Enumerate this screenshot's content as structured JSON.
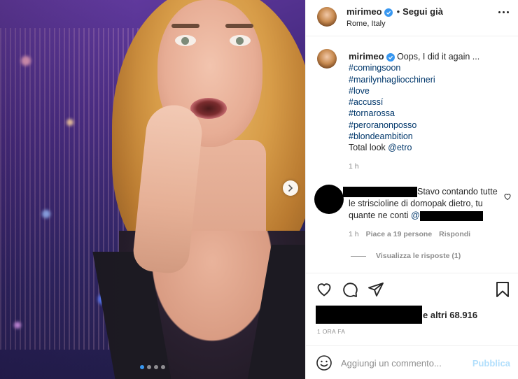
{
  "post": {
    "username": "mirimeo",
    "follow_label": "Segui già",
    "separator": "•",
    "location": "Rome, Italy",
    "verified_icon": "verified-badge-icon"
  },
  "caption": {
    "username": "mirimeo",
    "text": "Oops, I did it again ...",
    "hashtags": [
      "#comingsoon",
      "#marilynhagliocchineri",
      "#love",
      "#accussí",
      "#tornarossa",
      "#peroranonposso",
      "#blondeambition"
    ],
    "total_look_prefix": "Total look ",
    "mention": "@etro",
    "time": "1 h"
  },
  "comment": {
    "text_part1": "Stavo contando tutte le striscioline di domopak dietro, tu quante ne conti ",
    "mention_prefix": "@",
    "time": "1 h",
    "likes": "Piace a 19 persone",
    "reply_label": "Rispondi",
    "view_replies": "Visualizza le risposte (1)"
  },
  "likes": {
    "suffix": "e altri 68.916"
  },
  "post_time": "1 ORA FA",
  "add_comment": {
    "placeholder": "Aggiungi un commento...",
    "publish_label": "Pubblica"
  },
  "carousel": {
    "slide_count": 4,
    "active_index": 0
  },
  "colors": {
    "link": "#00376b",
    "verified": "#3897f0",
    "muted": "#8e8e8e",
    "publish_disabled": "#b2dffc"
  }
}
